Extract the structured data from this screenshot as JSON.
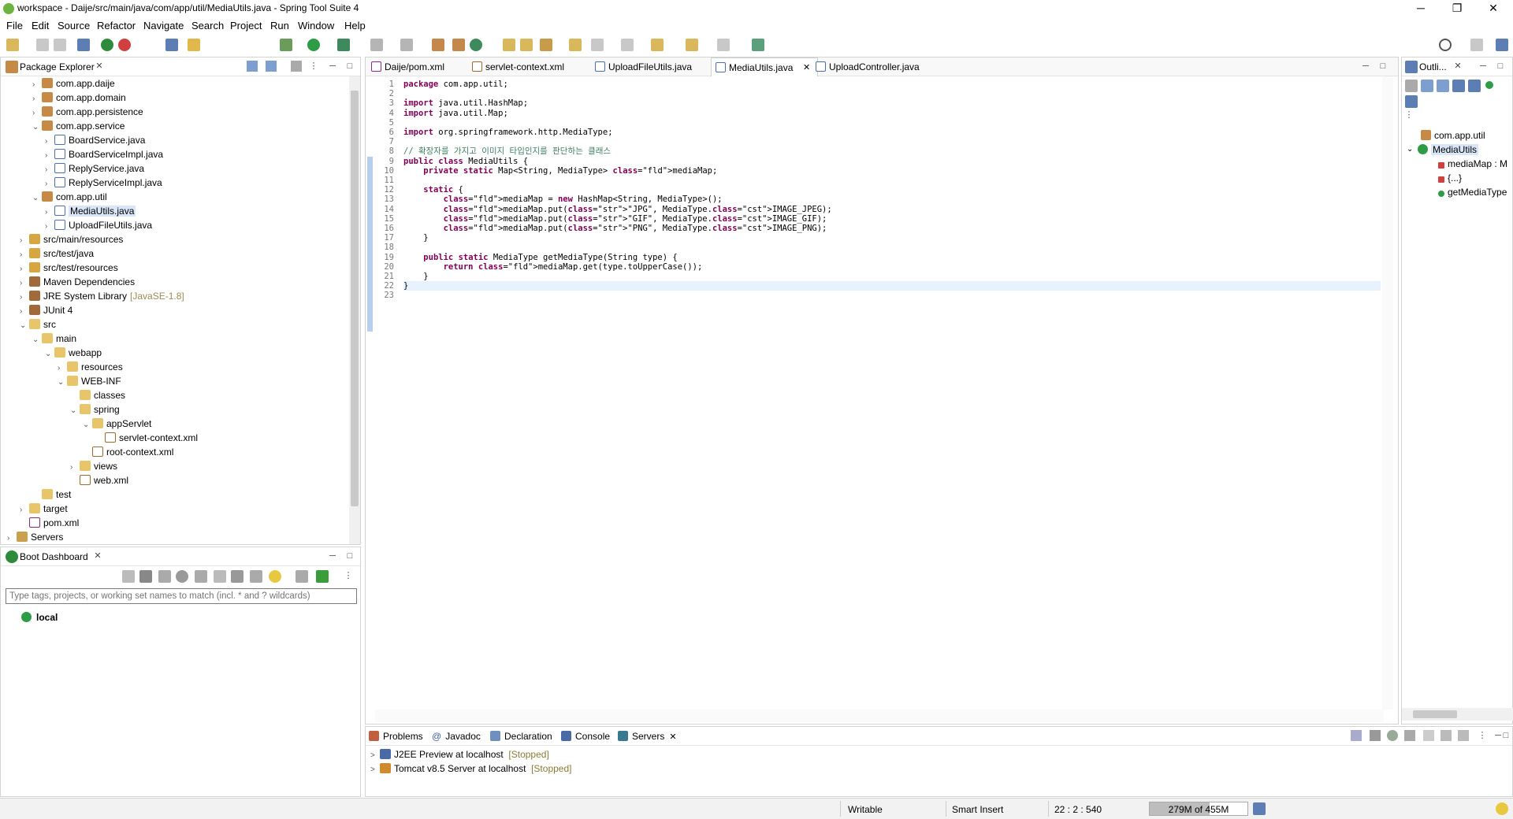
{
  "window": {
    "title": "workspace - Daije/src/main/java/com/app/util/MediaUtils.java - Spring Tool Suite 4",
    "minimize": "─",
    "maximize": "❐",
    "close": "✕"
  },
  "menu": [
    "File",
    "Edit",
    "Source",
    "Refactor",
    "Navigate",
    "Search",
    "Project",
    "Run",
    "Window",
    "Help"
  ],
  "package_explorer": {
    "title": "Package Explorer",
    "items": [
      {
        "label": "com.app.daije",
        "depth": 2,
        "icon": "package-icon",
        "twisty": ">"
      },
      {
        "label": "com.app.domain",
        "depth": 2,
        "icon": "package-icon",
        "twisty": ">"
      },
      {
        "label": "com.app.persistence",
        "depth": 2,
        "icon": "package-icon",
        "twisty": ">"
      },
      {
        "label": "com.app.service",
        "depth": 2,
        "icon": "package-icon",
        "twisty": "v"
      },
      {
        "label": "BoardService.java",
        "depth": 3,
        "icon": "java-file-icon",
        "twisty": ">"
      },
      {
        "label": "BoardServiceImpl.java",
        "depth": 3,
        "icon": "java-file-icon",
        "twisty": ">"
      },
      {
        "label": "ReplyService.java",
        "depth": 3,
        "icon": "java-file-icon",
        "twisty": ">"
      },
      {
        "label": "ReplyServiceImpl.java",
        "depth": 3,
        "icon": "java-file-icon",
        "twisty": ">"
      },
      {
        "label": "com.app.util",
        "depth": 2,
        "icon": "package-icon",
        "twisty": "v"
      },
      {
        "label": "MediaUtils.java",
        "depth": 3,
        "icon": "java-file-icon",
        "twisty": ">",
        "selected": true
      },
      {
        "label": "UploadFileUtils.java",
        "depth": 3,
        "icon": "java-file-icon",
        "twisty": ">"
      },
      {
        "label": "src/main/resources",
        "depth": 1,
        "icon": "source-folder-icon",
        "twisty": ">"
      },
      {
        "label": "src/test/java",
        "depth": 1,
        "icon": "source-folder-icon",
        "twisty": ">"
      },
      {
        "label": "src/test/resources",
        "depth": 1,
        "icon": "source-folder-icon",
        "twisty": ">"
      },
      {
        "label": "Maven Dependencies",
        "depth": 1,
        "icon": "library-icon",
        "twisty": ">"
      },
      {
        "label": "JRE System Library",
        "suffix": "[JavaSE-1.8]",
        "depth": 1,
        "icon": "library-icon",
        "twisty": ">"
      },
      {
        "label": "JUnit 4",
        "depth": 1,
        "icon": "library-icon",
        "twisty": ">"
      },
      {
        "label": "src",
        "depth": 1,
        "icon": "folder-icon",
        "twisty": "v"
      },
      {
        "label": "main",
        "depth": 2,
        "icon": "folder-icon",
        "twisty": "v"
      },
      {
        "label": "webapp",
        "depth": 3,
        "icon": "folder-icon",
        "twisty": "v"
      },
      {
        "label": "resources",
        "depth": 4,
        "icon": "folder-icon",
        "twisty": ">"
      },
      {
        "label": "WEB-INF",
        "depth": 4,
        "icon": "folder-icon",
        "twisty": "v"
      },
      {
        "label": "classes",
        "depth": 5,
        "icon": "folder-icon",
        "twisty": ""
      },
      {
        "label": "spring",
        "depth": 5,
        "icon": "folder-icon",
        "twisty": "v"
      },
      {
        "label": "appServlet",
        "depth": 6,
        "icon": "folder-icon",
        "twisty": "v"
      },
      {
        "label": "servlet-context.xml",
        "depth": 7,
        "icon": "xml-file-icon",
        "twisty": ""
      },
      {
        "label": "root-context.xml",
        "depth": 6,
        "icon": "xml-file-icon",
        "twisty": ""
      },
      {
        "label": "views",
        "depth": 5,
        "icon": "folder-icon",
        "twisty": ">"
      },
      {
        "label": "web.xml",
        "depth": 5,
        "icon": "xml-file-icon",
        "twisty": ""
      },
      {
        "label": "test",
        "depth": 2,
        "icon": "folder-icon",
        "twisty": ""
      },
      {
        "label": "target",
        "depth": 1,
        "icon": "folder-icon",
        "twisty": ">"
      },
      {
        "label": "pom.xml",
        "depth": 1,
        "icon": "maven-file-icon",
        "twisty": ""
      },
      {
        "label": "Servers",
        "depth": 0,
        "icon": "servers-folder-icon",
        "twisty": ">"
      }
    ]
  },
  "boot_dashboard": {
    "title": "Boot Dashboard",
    "filter_placeholder": "Type tags, projects, or working set names to match (incl. * and ? wildcards)",
    "items": [
      "local"
    ]
  },
  "editor": {
    "tabs": [
      {
        "label": "Daije/pom.xml",
        "icon": "maven-file-icon"
      },
      {
        "label": "servlet-context.xml",
        "icon": "xml-file-icon"
      },
      {
        "label": "UploadFileUtils.java",
        "icon": "java-file-icon"
      },
      {
        "label": "MediaUtils.java",
        "icon": "java-file-icon",
        "active": true
      },
      {
        "label": "UploadController.java",
        "icon": "java-file-icon"
      }
    ],
    "lines": [
      "package com.app.util;",
      "",
      "import java.util.HashMap;",
      "import java.util.Map;",
      "",
      "import org.springframework.http.MediaType;",
      "",
      "// 확장자를 가지고 이미지 타입인지를 판단하는 클래스",
      "public class MediaUtils {",
      "    private static Map<String, MediaType> mediaMap;",
      "",
      "    static {",
      "        mediaMap = new HashMap<String, MediaType>();",
      "        mediaMap.put(\"JPG\", MediaType.IMAGE_JPEG);",
      "        mediaMap.put(\"GIF\", MediaType.IMAGE_GIF);",
      "        mediaMap.put(\"PNG\", MediaType.IMAGE_PNG);",
      "    }",
      "",
      "    public static MediaType getMediaType(String type) {",
      "        return mediaMap.get(type.toUpperCase());",
      "    }",
      "}",
      ""
    ]
  },
  "outline": {
    "title": "Outli...",
    "items": [
      {
        "label": "com.app.util",
        "icon": "package-icon"
      },
      {
        "label": "MediaUtils",
        "icon": "class-icon"
      },
      {
        "label": "mediaMap : M",
        "icon": "private-field-icon"
      },
      {
        "label": "{...}",
        "icon": "static-initializer-icon"
      },
      {
        "label": "getMediaType",
        "icon": "public-method-icon"
      }
    ]
  },
  "bottom": {
    "tabs": [
      "Problems",
      "Javadoc",
      "Declaration",
      "Console",
      "Servers"
    ],
    "servers": [
      {
        "name": "J2EE Preview at localhost",
        "status": "[Stopped]"
      },
      {
        "name": "Tomcat v8.5 Server at localhost",
        "status": "[Stopped]"
      }
    ]
  },
  "status": {
    "writable": "Writable",
    "insert_mode": "Smart Insert",
    "position": "22 : 2 : 540",
    "memory": "279M of 455M",
    "memory_fraction": 0.613
  },
  "colors": {
    "selection": "#d9e6f7",
    "spring_green": "#6db33f",
    "keyword": "#7f0055",
    "field": "#0000c0",
    "string": "#2a00ff",
    "comment": "#3f7f5f"
  }
}
